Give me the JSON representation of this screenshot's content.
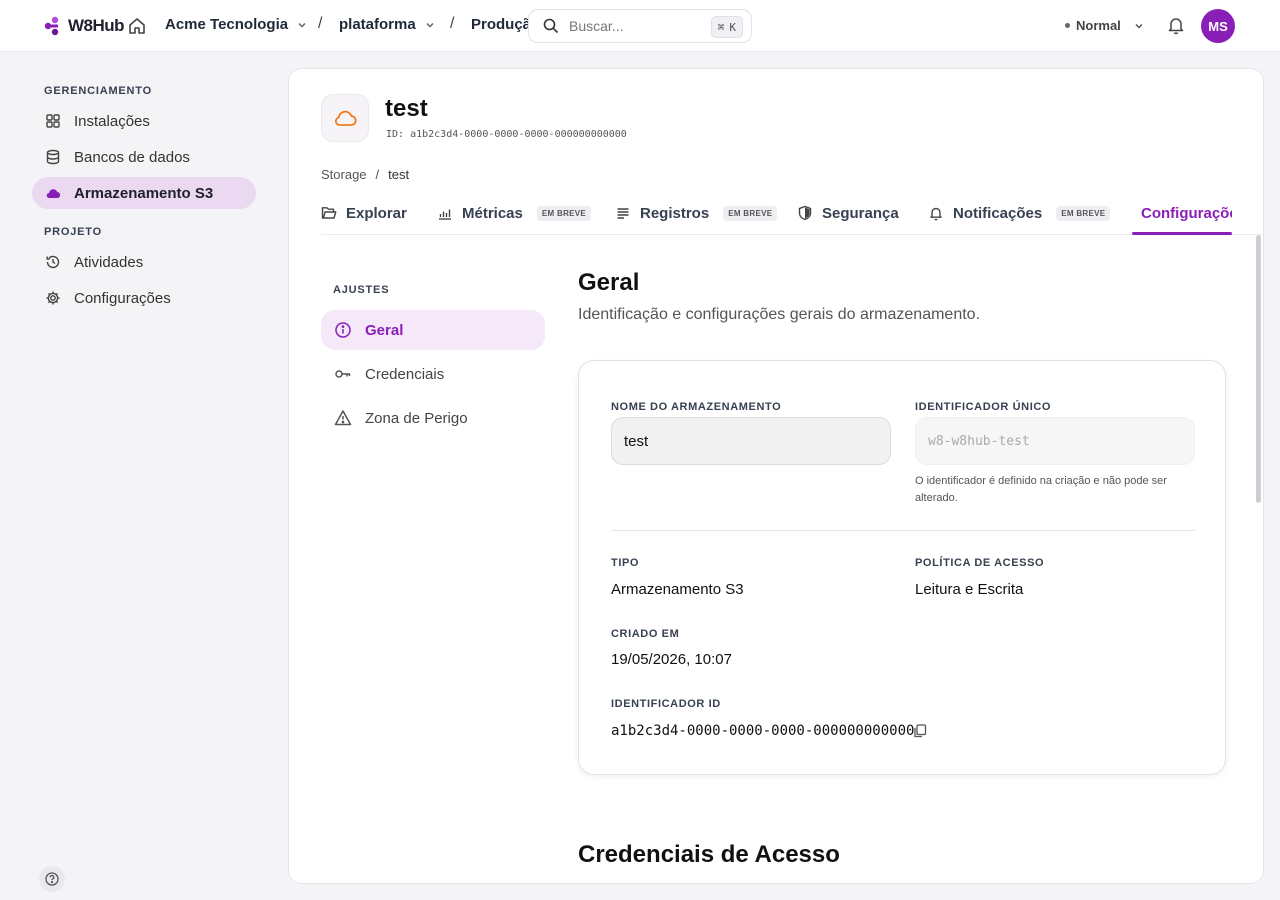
{
  "topbar": {
    "logo": "W8Hub",
    "org": "Acme Tecnologia",
    "project": "plataforma",
    "environment": "Produção",
    "search_placeholder": "Buscar...",
    "search_shortcut_mod": "⌘",
    "search_shortcut_key": "K",
    "mode": "Normal",
    "avatar_initials": "MS"
  },
  "sidebar": {
    "section1": "GERENCIAMENTO",
    "items1": [
      {
        "label": "Instalações",
        "icon": "grid-icon"
      },
      {
        "label": "Bancos de dados",
        "icon": "database-icon"
      },
      {
        "label": "Armazenamento S3",
        "icon": "cloud-icon",
        "active": true
      }
    ],
    "section2": "PROJETO",
    "items2": [
      {
        "label": "Atividades",
        "icon": "history-icon"
      },
      {
        "label": "Configurações",
        "icon": "gear-icon"
      }
    ]
  },
  "resource": {
    "name": "test",
    "id_line": "ID: a1b2c3d4-0000-0000-0000-000000000000"
  },
  "breadcrumb": {
    "parent": "Storage",
    "sep": "/",
    "current": "test"
  },
  "tabs": [
    {
      "label": "Explorar"
    },
    {
      "label": "Métricas",
      "badge": "EM BREVE"
    },
    {
      "label": "Registros",
      "badge": "EM BREVE"
    },
    {
      "label": "Segurança"
    },
    {
      "label": "Notificações",
      "badge": "EM BREVE"
    },
    {
      "label": "Configurações",
      "active": true
    }
  ],
  "settings_nav": {
    "title": "AJUSTES",
    "items": [
      {
        "label": "Geral",
        "active": true
      },
      {
        "label": "Credenciais"
      },
      {
        "label": "Zona de Perigo"
      }
    ]
  },
  "general": {
    "title": "Geral",
    "description": "Identificação e configurações gerais do armazenamento.",
    "name_label": "NOME DO ARMAZENAMENTO",
    "name_value": "test",
    "uid_label": "IDENTIFICADOR ÚNICO",
    "uid_value": "w8-w8hub-test",
    "uid_hint": "O identificador é definido na criação e não pode ser alterado.",
    "type_label": "TIPO",
    "type_value": "Armazenamento S3",
    "policy_label": "POLÍTICA DE ACESSO",
    "policy_value": "Leitura e Escrita",
    "created_label": "CRIADO EM",
    "created_value": "19/05/2026, 10:07",
    "id_label": "IDENTIFICADOR ID",
    "id_value": "a1b2c3d4-0000-0000-0000-000000000000"
  },
  "credentials": {
    "title": "Credenciais de Acesso"
  },
  "colors": {
    "accent": "#8a1fb8",
    "accent_soft": "#ead9f1",
    "cloud": "#f07a1e"
  }
}
